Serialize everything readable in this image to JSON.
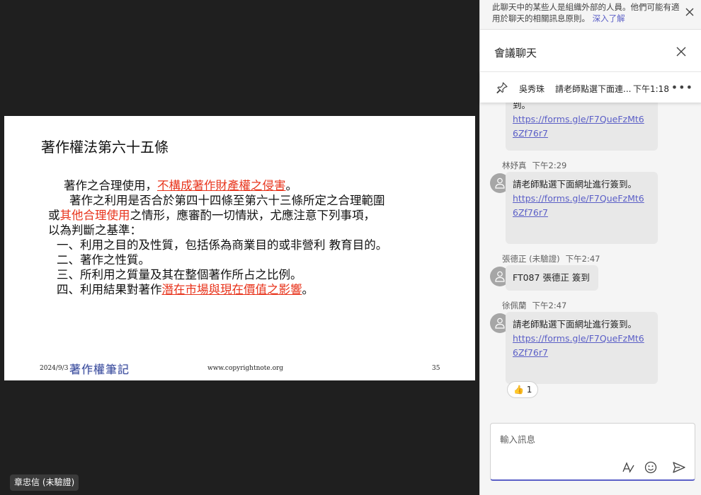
{
  "slide": {
    "title": "著作權法第六十五條",
    "line1_pre": "著作之合理使用，",
    "line1_red": "不構成著作財產權之侵害",
    "line1_post": "。",
    "line2": "著作之利用是否合於第四十四條至第六十三條所定之合理範圍",
    "line3_pre": "或",
    "line3_red": "其他合理使用",
    "line3_post": "之情形，應審酌一切情狀，尤應注意下列事項，",
    "line4": "以為判斷之基準：",
    "item1": "一、利用之目的及性質，包括係為商業目的或非營利 教育目的。",
    "item2": "二、著作之性質。",
    "item3": "三、所利用之質量及其在整個著作所占之比例。",
    "item4_pre": "四、利用結果對著作",
    "item4_red": "潛在市場與現在價值之影響",
    "item4_post": "。",
    "footer_date": "2024/9/3",
    "footer_logo": "著作權筆記",
    "footer_url": "www.copyrightnote.org",
    "footer_page": "35"
  },
  "presenter": {
    "name": "章忠信 (未驗證)"
  },
  "chat": {
    "notice_text": "此聊天中的某些人是組織外部的人員。他們可能有適用於聊天的相關訊息原則。",
    "notice_link": "深入了解",
    "title": "會議聊天",
    "pinned": {
      "author": "吳秀珠",
      "text": "請老師點選下面連...",
      "time": "下午1:18"
    },
    "messages": [
      {
        "text": "到。",
        "link": "https://forms.gle/F7QueFzMt66Zf76r7"
      },
      {
        "author": "林妤真",
        "time": "下午2:29",
        "text": "請老師點選下面網址進行簽到。",
        "link": "https://forms.gle/F7QueFzMt66Zf76r7"
      },
      {
        "author": "張德正 (未驗證)",
        "time": "下午2:47",
        "text": "FT087 張德正 簽到"
      },
      {
        "author": "徐佩蘭",
        "time": "下午2:47",
        "text": "請老師點選下面網址進行簽到。",
        "link": "https://forms.gle/F7QueFzMt66Zf76r7",
        "reaction_emoji": "👍",
        "reaction_count": "1"
      }
    ],
    "composer_placeholder": "輸入訊息"
  },
  "colors": {
    "accent": "#5b5fc7",
    "slide_red": "#e8341c"
  }
}
